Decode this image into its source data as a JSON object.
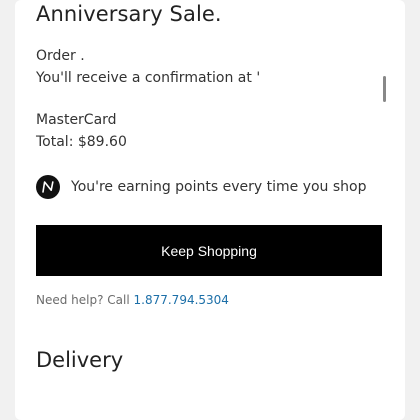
{
  "header": {
    "title": "Anniversary Sale."
  },
  "order": {
    "label": "Order .",
    "confirmation": "You'll receive a confirmation at '"
  },
  "payment": {
    "card_type": "MasterCard",
    "total": "Total: $89.60"
  },
  "rewards": {
    "icon": "nordstrom-n-icon",
    "text": "You're earning points every time you shop"
  },
  "actions": {
    "keep_shopping": "Keep Shopping"
  },
  "help": {
    "prefix": "Need help? Call ",
    "phone": "1.877.794.5304"
  },
  "delivery": {
    "title": "Delivery"
  },
  "colors": {
    "accent_link": "#1c6fa8",
    "button_bg": "#000000",
    "page_bg": "#f1f1f1"
  }
}
